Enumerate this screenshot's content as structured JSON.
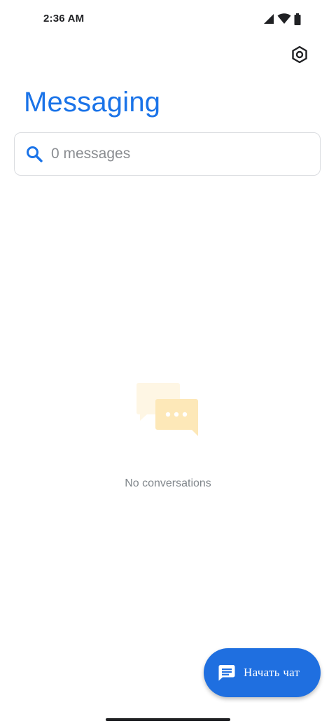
{
  "status_bar": {
    "time": "2:36 AM",
    "icons": [
      "cell-signal-icon",
      "wifi-icon",
      "battery-icon"
    ]
  },
  "header": {
    "title": "Messaging",
    "settings_icon": "settings-icon"
  },
  "search": {
    "placeholder": "0 messages",
    "value": "",
    "icon": "search-icon"
  },
  "empty_state": {
    "icon": "conversation-bubbles-icon",
    "text": "No conversations"
  },
  "fab": {
    "icon": "chat-icon",
    "label": "Начать чат"
  },
  "colors": {
    "accent": "#1a73e8",
    "fab_background": "#1f6fe0",
    "empty_icon": "#fde8b8"
  }
}
